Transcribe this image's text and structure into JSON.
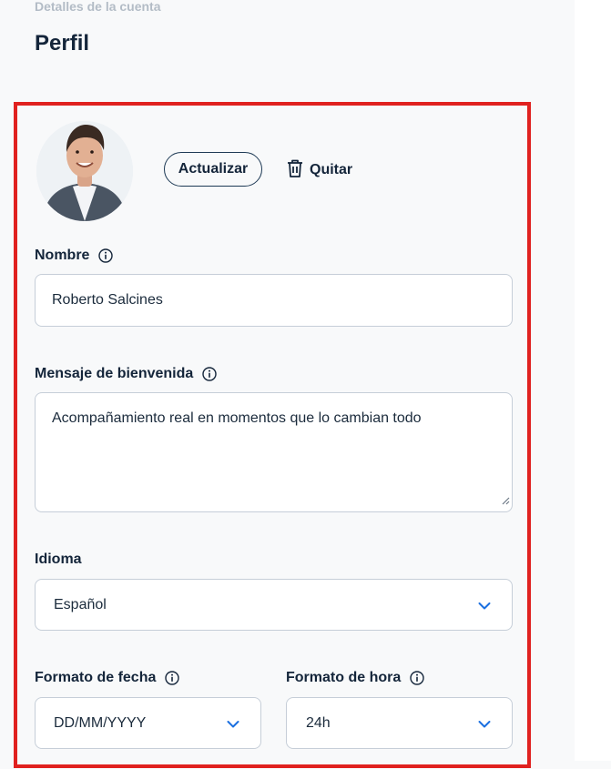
{
  "header": {
    "section_title": "Detalles de la cuenta",
    "page_title": "Perfil"
  },
  "avatar": {
    "update_label": "Actualizar",
    "remove_label": "Quitar"
  },
  "form": {
    "name": {
      "label": "Nombre",
      "value": "Roberto Salcines"
    },
    "welcome": {
      "label": "Mensaje de bienvenida",
      "value": "Acompañamiento real en momentos que lo cambian todo"
    },
    "language": {
      "label": "Idioma",
      "value": "Español"
    },
    "date_format": {
      "label": "Formato de fecha",
      "value": "DD/MM/YYYY"
    },
    "time_format": {
      "label": "Formato de hora",
      "value": "24h"
    }
  },
  "colors": {
    "highlight_border": "#e0211f",
    "chevron": "#1a6fe0",
    "text": "#14253a"
  },
  "icons": [
    "info-icon",
    "trash-icon",
    "chevron-down-icon",
    "resize-grip-icon"
  ]
}
